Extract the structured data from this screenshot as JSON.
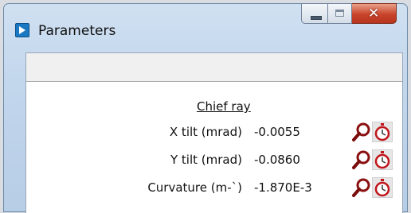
{
  "window": {
    "title": "Parameters",
    "controls": {
      "minimize": "minimize",
      "maximize": "maximize",
      "close": "close"
    }
  },
  "section": {
    "title": "Chief ray",
    "rows": [
      {
        "label": "X tilt (mrad)",
        "value": "-0.0055"
      },
      {
        "label": "Y tilt  (mrad)",
        "value": "-0.0860"
      },
      {
        "label": "Curvature (m-`)",
        "value": "-1.870E-3"
      }
    ]
  },
  "icons": {
    "search": "magnifier-icon",
    "timer": "stopwatch-icon",
    "app": "app-icon"
  },
  "colors": {
    "titlebar": "#c2d6ec",
    "close": "#c8432a",
    "search_icon": "#8a0f0f",
    "timer_icon": "#c0161b"
  }
}
